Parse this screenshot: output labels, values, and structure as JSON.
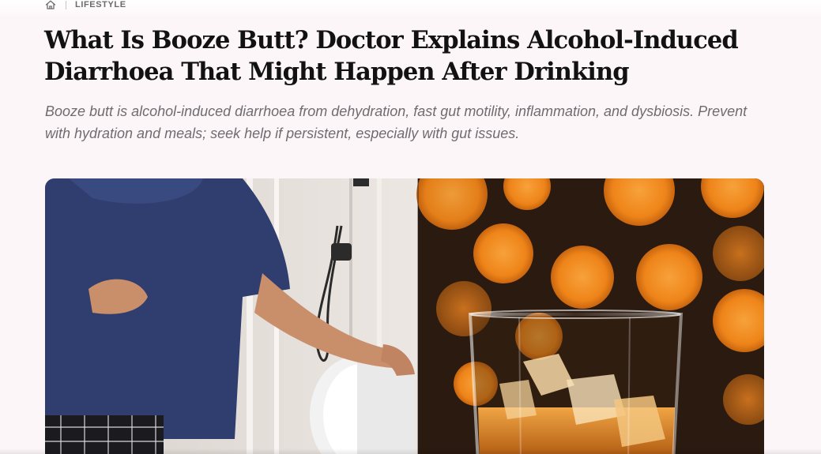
{
  "breadcrumb": {
    "home_icon": "home-icon",
    "category": "LIFESTYLE"
  },
  "article": {
    "title": "What Is Booze Butt? Doctor Explains Alcohol-Induced Diarrhoea That Might Happen After Drinking",
    "standfirst": "Booze butt is alcohol-induced diarrhoea from dehydration, fast gut motility, inflammation, and dysbiosis. Prevent with hydration and meals; seek help if persistent, especially with gut issues."
  },
  "hero_image": {
    "left_scene": "man holding stomach beside toilet in bathroom",
    "right_scene": "glass of whiskey with ice on orange bokeh background"
  },
  "colors": {
    "page_background": "#fdf6f8",
    "headline": "#121212",
    "standfirst": "#6e6c70",
    "breadcrumb": "#6d6a6c",
    "bokeh": "#f28c1e"
  }
}
